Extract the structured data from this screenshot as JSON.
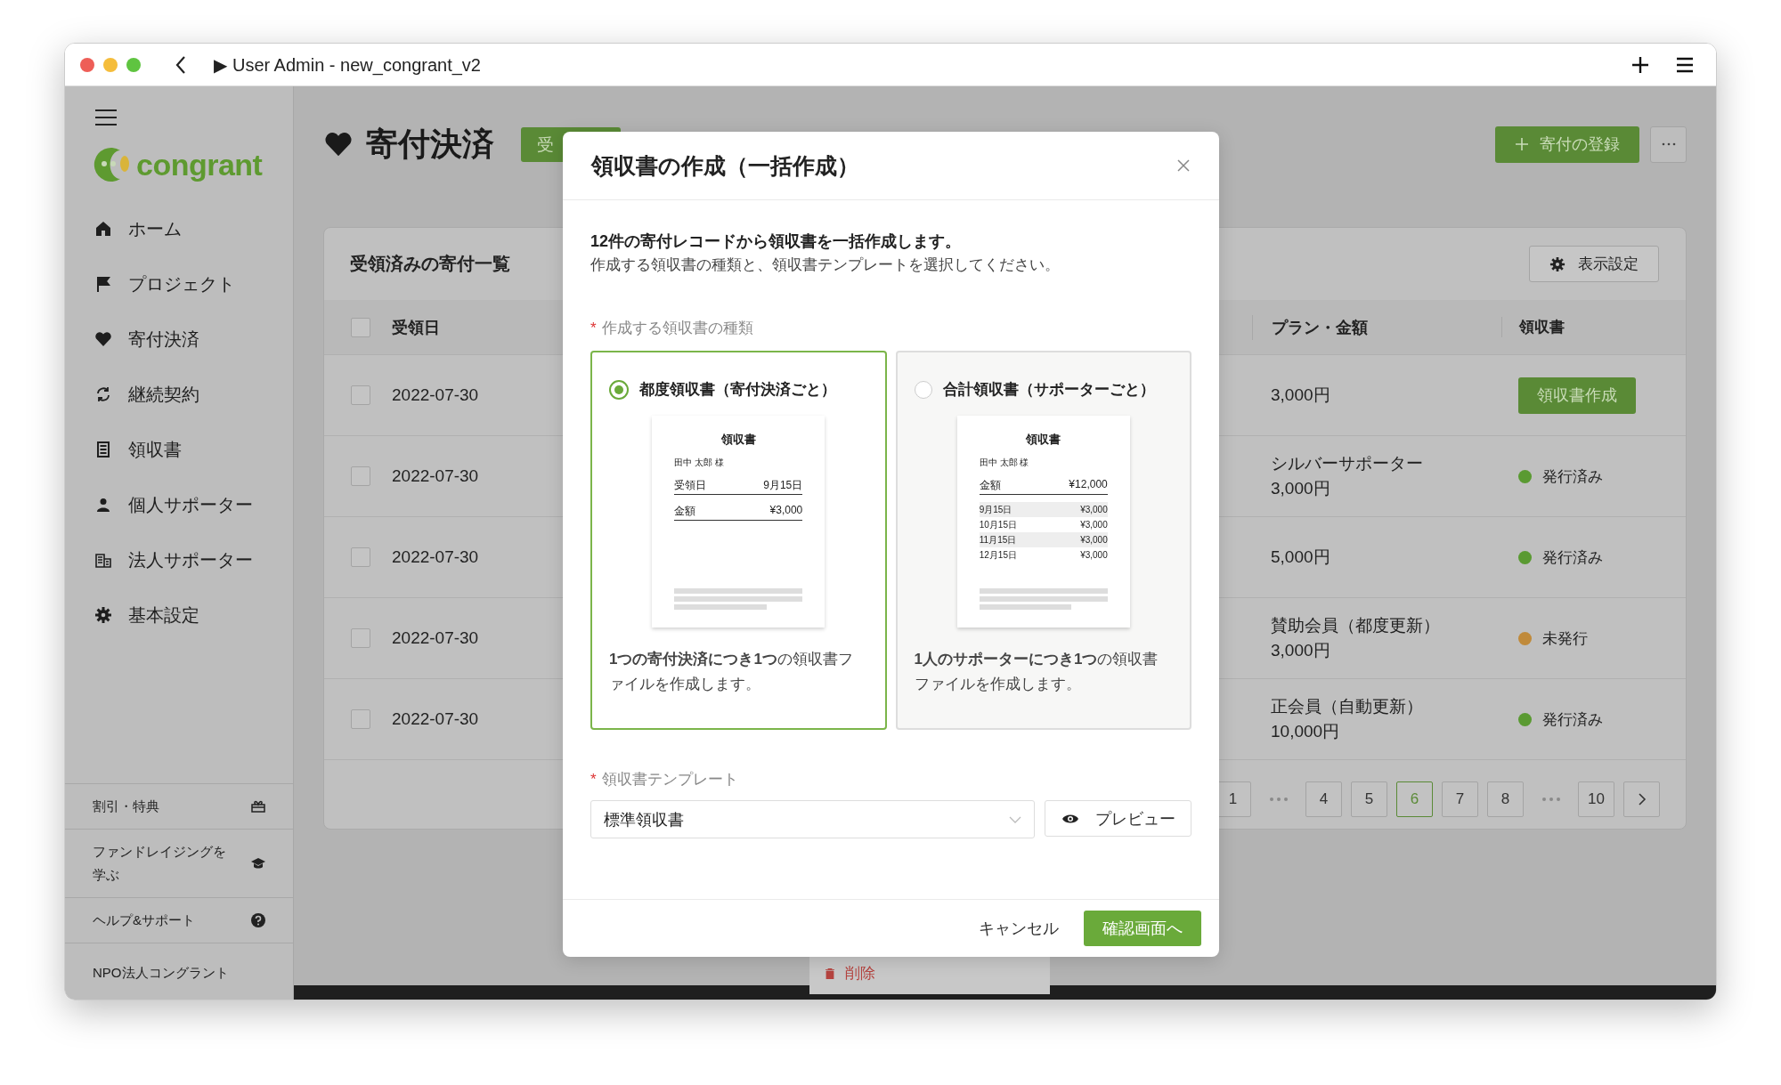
{
  "window": {
    "title": "▶ User Admin - new_congrant_v2"
  },
  "sidebar": {
    "logo": "congrant",
    "items": [
      {
        "label": "ホーム"
      },
      {
        "label": "プロジェクト"
      },
      {
        "label": "寄付決済"
      },
      {
        "label": "継続契約"
      },
      {
        "label": "領収書"
      },
      {
        "label": "個人サポーター"
      },
      {
        "label": "法人サポーター"
      },
      {
        "label": "基本設定"
      }
    ],
    "footer_links": [
      {
        "label": "割引・特典"
      },
      {
        "label": "ファンドレイジングを学ぶ"
      },
      {
        "label": "ヘルプ&サポート"
      }
    ],
    "organization": "NPO法人コングラント"
  },
  "page": {
    "title": "寄付決済",
    "tab": "受",
    "register_button": "寄付の登録"
  },
  "card": {
    "title": "受領済みの寄付一覧",
    "settings_button": "表示設定",
    "header_checked": false,
    "columns": [
      "受領日",
      "プラン・金額",
      "領収書"
    ],
    "rows": [
      {
        "checked": false,
        "date": "2022-07-30",
        "amount": "3,000円",
        "receipt": {
          "kind": "button",
          "label": "領収書作成"
        }
      },
      {
        "checked": false,
        "date": "2022-07-30",
        "plan": "シルバーサポーター",
        "amount": "3,000円",
        "receipt": {
          "kind": "status",
          "label": "発行済み",
          "color": "#5a9a32"
        }
      },
      {
        "checked": false,
        "date": "2022-07-30",
        "amount": "5,000円",
        "receipt": {
          "kind": "status",
          "label": "発行済み",
          "color": "#5a9a32"
        }
      },
      {
        "checked": false,
        "date": "2022-07-30",
        "plan": "賛助会員（都度更新）",
        "amount": "3,000円",
        "receipt": {
          "kind": "status",
          "label": "未発行",
          "color": "#c08a3a"
        }
      },
      {
        "checked": false,
        "date": "2022-07-30",
        "plan": "正会員（自動更新）",
        "amount": "10,000円",
        "receipt": {
          "kind": "status",
          "label": "発行済み",
          "color": "#5a9a32"
        }
      }
    ],
    "pagination": [
      {
        "kind": "page",
        "label": "1",
        "selected": false
      },
      {
        "kind": "ellipsis"
      },
      {
        "kind": "page",
        "label": "4",
        "selected": false
      },
      {
        "kind": "page",
        "label": "5",
        "selected": false
      },
      {
        "kind": "page",
        "label": "6",
        "selected": true
      },
      {
        "kind": "page",
        "label": "7",
        "selected": false
      },
      {
        "kind": "page",
        "label": "8",
        "selected": false
      },
      {
        "kind": "ellipsis"
      },
      {
        "kind": "page",
        "label": "10",
        "selected": false
      },
      {
        "kind": "next"
      }
    ]
  },
  "row_menu": {
    "delete": "削除"
  },
  "modal": {
    "title": "領収書の作成（一括作成）",
    "intro": "12件の寄付レコードから領収書を一括作成します。",
    "instruction": "作成する領収書の種類と、領収書テンプレートを選択してください。",
    "type_label": {
      "mark": "*",
      "text": "作成する領収書の種類"
    },
    "options": [
      {
        "title": "都度領収書（寄付決済ごと）",
        "selected": true,
        "description": "**1つの寄付決済につき1つ**の領収書ファイルを作成します。",
        "sample": {
          "heading": "領収書",
          "addressee": "田中 太郎 様",
          "fields": [
            {
              "label": "受領日",
              "value": "9月15日"
            },
            {
              "label": "金額",
              "value": "¥3,000"
            }
          ]
        }
      },
      {
        "title": "合計領収書（サポーターごと）",
        "selected": false,
        "description": "**1人のサポーターにつき1つ**の領収書ファイルを作成します。",
        "sample": {
          "heading": "領収書",
          "addressee": "田中 太郎 様",
          "fields": [
            {
              "label": "金額",
              "value": "¥12,000"
            }
          ],
          "lines": [
            {
              "date": "9月15日",
              "amount": "¥3,000"
            },
            {
              "date": "10月15日",
              "amount": "¥3,000"
            },
            {
              "date": "11月15日",
              "amount": "¥3,000"
            },
            {
              "date": "12月15日",
              "amount": "¥3,000"
            }
          ]
        }
      }
    ],
    "template_label": {
      "mark": "*",
      "text": "領収書テンプレート"
    },
    "template_value": "標準領収書",
    "preview_button": "プレビュー",
    "cancel_button": "キャンセル",
    "confirm_button": "確認画面へ"
  }
}
